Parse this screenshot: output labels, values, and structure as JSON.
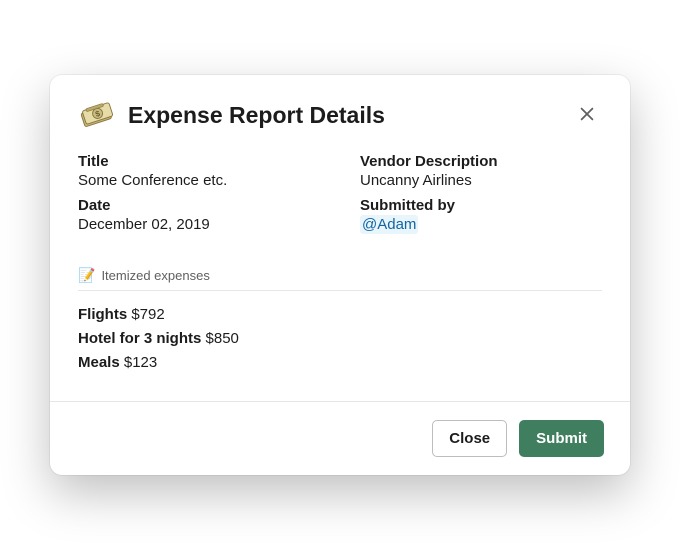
{
  "header": {
    "title": "Expense Report Details"
  },
  "fields": {
    "title_label": "Title",
    "title_value": "Some Conference etc.",
    "date_label": "Date",
    "date_value": "December 02, 2019",
    "vendor_label": "Vendor Description",
    "vendor_value": "Uncanny Airlines",
    "submitted_label": "Submitted by",
    "submitted_value": "@Adam"
  },
  "itemized": {
    "section_label": "Itemized expenses",
    "section_icon": "📝",
    "items": [
      {
        "name": "Flights",
        "amount": "$792"
      },
      {
        "name": "Hotel for 3 nights",
        "amount": "$850"
      },
      {
        "name": "Meals",
        "amount": "$123"
      }
    ]
  },
  "footer": {
    "close_label": "Close",
    "submit_label": "Submit"
  }
}
